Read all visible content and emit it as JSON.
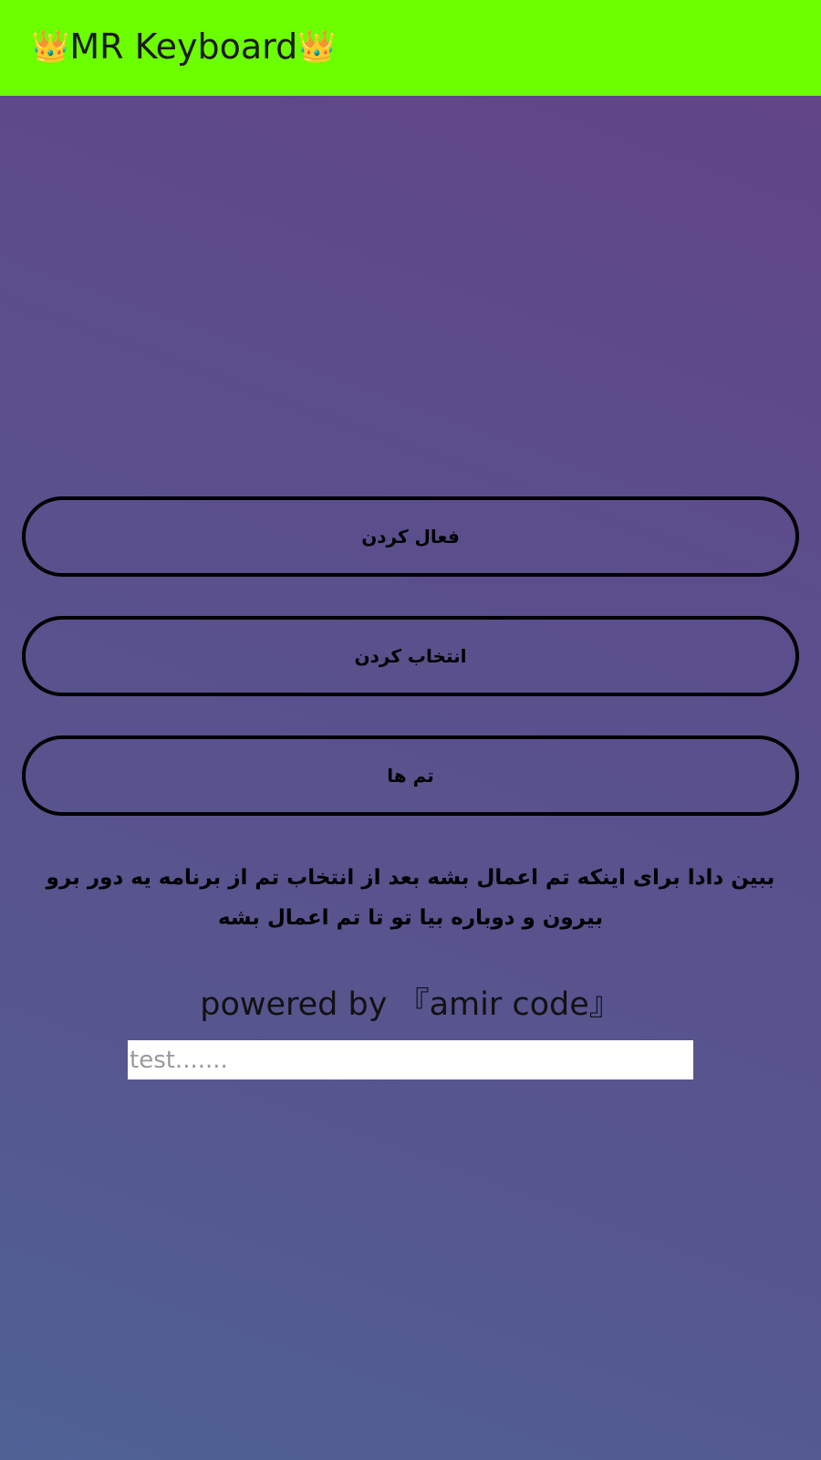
{
  "app_bar": {
    "crown_left": "👑",
    "title": "MR Keyboard",
    "crown_right": "👑",
    "color": "#6cff00"
  },
  "buttons": {
    "activate": "فعال کردن",
    "select": "انتخاب کردن",
    "themes": "تم ها"
  },
  "info_text": "ببین دادا برای اینکه تم اعمال بشه بعد از انتخاب تم از برنامه یه دور برو بیرون و دوباره بیا تو تا تم اعمال بشه",
  "powered_by": "powered by 『amir code』",
  "test_input": {
    "value": "",
    "placeholder": "test......."
  }
}
